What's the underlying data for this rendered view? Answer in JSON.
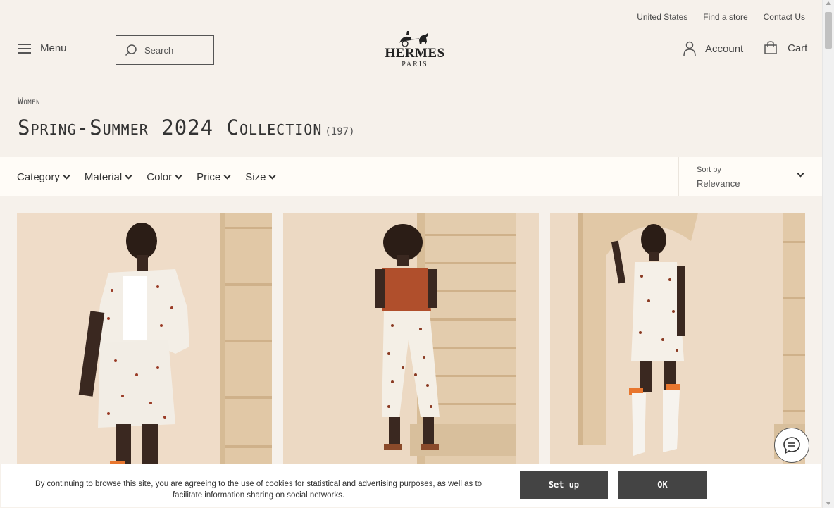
{
  "header": {
    "util_links": [
      "United States",
      "Find a store",
      "Contact Us"
    ],
    "menu_label": "Menu",
    "search_placeholder": "Search",
    "logo_brand": "HERMES",
    "logo_city": "PARIS",
    "account_label": "Account",
    "cart_label": "Cart"
  },
  "breadcrumb": "Women",
  "page_title": "Spring-Summer 2024 Collection",
  "item_count": "(197)",
  "filters": [
    "Category",
    "Material",
    "Color",
    "Price",
    "Size"
  ],
  "sort": {
    "label": "Sort by",
    "value": "Relevance"
  },
  "products": [
    {
      "desc": "model-jacket-skirt",
      "palette": {
        "bg": "#ecd8c2",
        "outfit": "#f4f0ea",
        "accent": "#c9733c"
      }
    },
    {
      "desc": "model-tshirt-trousers",
      "palette": {
        "bg": "#ead5bf",
        "outfit": "#f4efe6",
        "accent": "#b04f2c"
      }
    },
    {
      "desc": "model-dress-boots",
      "palette": {
        "bg": "#e9d3bc",
        "outfit": "#f5f0e8",
        "accent": "#e8762e"
      }
    }
  ],
  "cookie": {
    "message": "By continuing to browse this site, you are agreeing to the use of cookies for statistical and advertising purposes, as well as to facilitate information sharing on social networks.",
    "setup_label": "Set up",
    "ok_label": "OK"
  },
  "icons": [
    "menu-icon",
    "search-icon",
    "account-icon",
    "cart-icon",
    "chat-icon",
    "chevron-down-icon"
  ]
}
